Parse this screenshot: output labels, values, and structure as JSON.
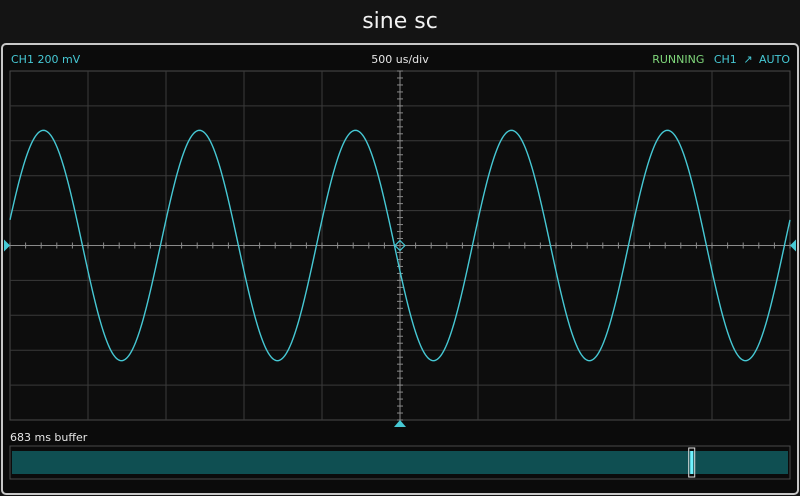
{
  "app": {
    "title": "sine sc"
  },
  "status": {
    "channel_scale": "CH1 200 mV",
    "timebase": "500 us/div",
    "run_state": "RUNNING",
    "trigger_channel": "CH1",
    "trigger_edge_symbol": "⎍",
    "trigger_mode": "AUTO"
  },
  "buffer": {
    "label": "683 ms buffer",
    "view_position_fraction": 0.874
  },
  "trace": {
    "cycles_on_screen": 5,
    "amplitude_divisions": 3.3,
    "phase": "sine, zero-crossing rising at left edge"
  },
  "colors": {
    "trace": "#46c8d4",
    "grid": "#3a3a3a",
    "axis": "#8a8a8a",
    "running": "#7fd77a",
    "buffer_fill": "#0f4f52"
  },
  "icons": {
    "left_marker": "ground-level-marker-icon",
    "right_marker": "trigger-level-marker-icon",
    "bottom_marker": "trigger-position-marker-icon",
    "center": "trigger-point-icon"
  }
}
